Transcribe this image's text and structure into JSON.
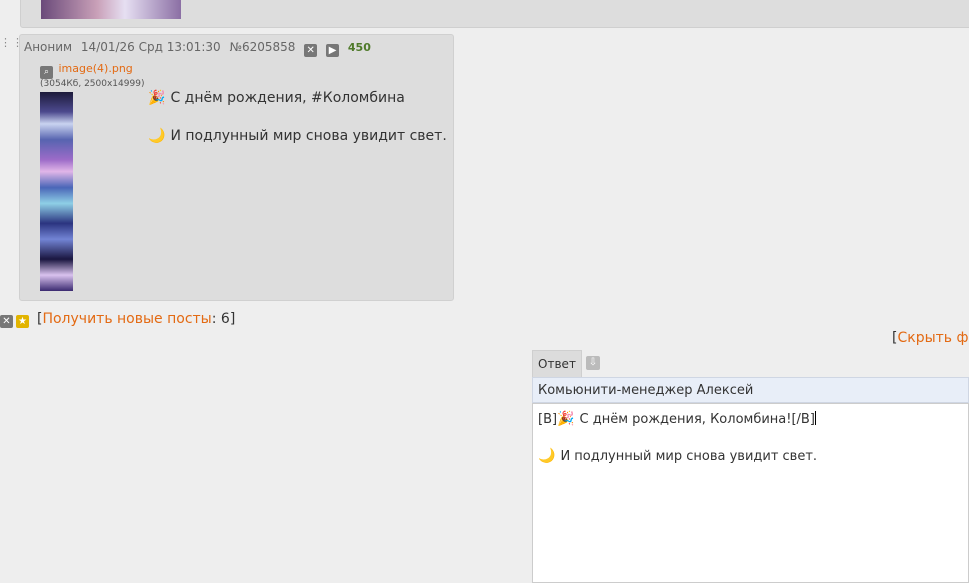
{
  "previous_post": {
    "thumbnail": "image-thumbnail"
  },
  "post": {
    "author": "Аноним",
    "date": "14/01/26 Срд 13:01:30",
    "number": "№6205858",
    "hide_icon": "x-icon",
    "play_icon": "play-icon",
    "reply_count": "450",
    "file": {
      "name": "image(4).png",
      "meta": "(3054Кб, 2500x14999)",
      "zoom_icon": "magnifier-icon"
    },
    "lines": [
      {
        "emoji": "🎉",
        "text": "С днём рождения, #Коломбина"
      },
      {
        "emoji": "🌙",
        "text": "И подлунный мир снова увидит свет."
      }
    ]
  },
  "new_posts": {
    "open_bracket": "[",
    "label": "Получить новые посты",
    "sep": ": ",
    "count": "6",
    "close_bracket": "]"
  },
  "hide_form": {
    "open_bracket": "[",
    "label": "Скрыть фо"
  },
  "reply_form": {
    "tab_label": "Ответ",
    "name_value": "Комьюнити-менеджер Алексей",
    "comment_lines": [
      {
        "prefix": "[B]",
        "emoji": "🎉",
        "text": "С днём рождения, Коломбина![/B]"
      },
      {
        "prefix": "",
        "emoji": "🌙",
        "text": "И подлунный мир снова увидит свет."
      }
    ]
  },
  "colors": {
    "link": "#e36a13",
    "post_bg": "#dddddd",
    "page_bg": "#eeeeee",
    "reply_count": "#4f7a2a"
  }
}
